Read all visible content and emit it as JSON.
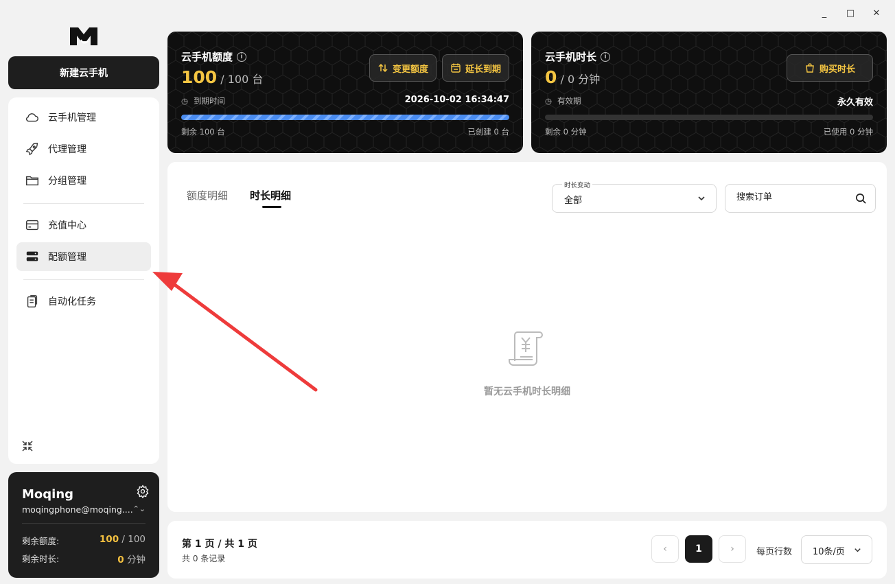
{
  "window": {
    "minimize": "_",
    "maximize": "□",
    "close": "✕"
  },
  "sidebar": {
    "new_button": "新建云手机",
    "items": [
      {
        "label": "云手机管理",
        "icon": "cloud-icon"
      },
      {
        "label": "代理管理",
        "icon": "rocket-icon"
      },
      {
        "label": "分组管理",
        "icon": "folder-icon"
      },
      {
        "label": "充值中心",
        "icon": "card-icon"
      },
      {
        "label": "配额管理",
        "icon": "server-icon",
        "active": true
      },
      {
        "label": "自动化任务",
        "icon": "clipboard-icon"
      }
    ]
  },
  "user": {
    "name": "Moqing",
    "email": "moqingphone@moqing....",
    "quota_label": "剩余额度:",
    "quota_value": "100",
    "quota_total": " / 100",
    "time_label": "剩余时长:",
    "time_value": "0",
    "time_unit": " 分钟"
  },
  "quota_card": {
    "title": "云手机额度",
    "value": "100",
    "total": " / 100 台",
    "btn_change": "变更额度",
    "btn_extend": "延长到期",
    "expire_label": "到期时间",
    "expire_value": "2026-10-02 16:34:47",
    "progress": 1.0,
    "remain": "剩余 100 台",
    "created": "已创建 0 台"
  },
  "time_card": {
    "title": "云手机时长",
    "value": "0",
    "total": " / 0 分钟",
    "btn_buy": "购买时长",
    "valid_label": "有效期",
    "valid_value": "永久有效",
    "progress": 0,
    "remain": "剩余 0 分钟",
    "used": "已使用 0 分钟"
  },
  "main": {
    "tabs": [
      "额度明细",
      "时长明细"
    ],
    "active_tab": "时长明细",
    "filter_label": "时长变动",
    "filter_value": "全部",
    "search_placeholder": "搜索订单",
    "empty_text": "暂无云手机时长明细"
  },
  "pager": {
    "title": "第 1 页 / 共 1 页",
    "records": "共 0 条记录",
    "current_page": "1",
    "prev": "‹",
    "next": "›",
    "rows_label": "每页行数",
    "rows_value": "10条/页"
  },
  "colors": {
    "accent": "#f4c542",
    "dark": "#1e1e1e",
    "progress": "#4a8cf0",
    "annotation": "#ee3b3b"
  }
}
